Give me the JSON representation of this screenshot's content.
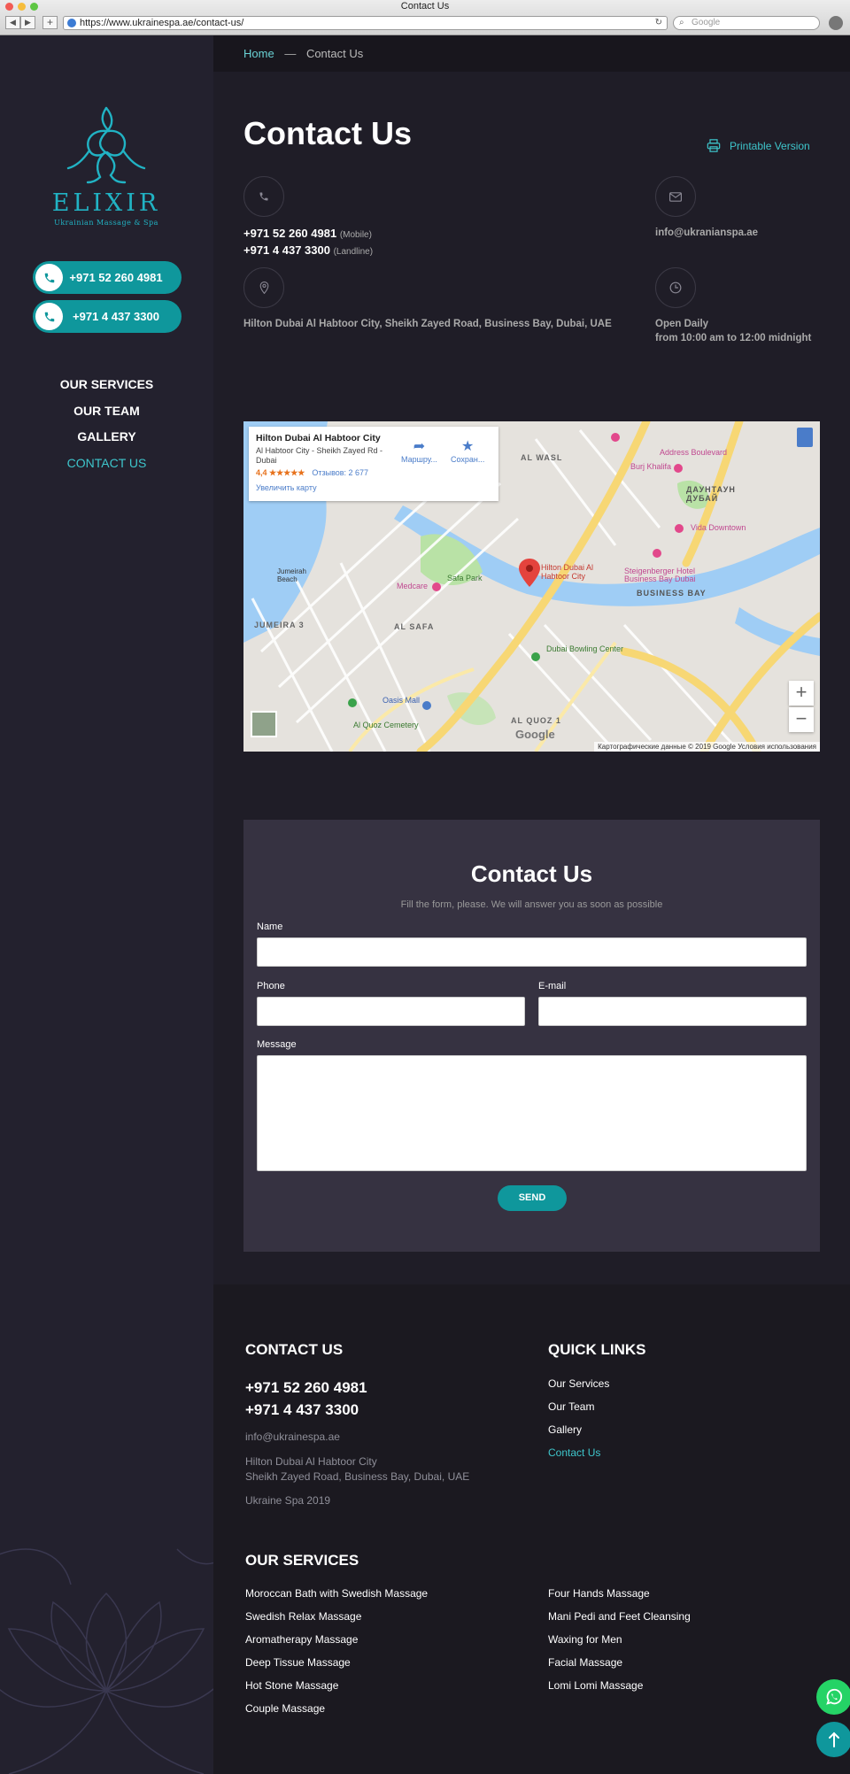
{
  "browser": {
    "window_title": "Contact Us",
    "url": "https://www.ukrainespa.ae/contact-us/",
    "search_placeholder": "Google"
  },
  "sidebar": {
    "brand": "ELIXIR",
    "tagline": "Ukrainian Massage & Spa",
    "phones": [
      "+971 52 260 4981",
      "+971 4 437 3300"
    ],
    "nav": [
      "OUR SERVICES",
      "OUR TEAM",
      "GALLERY",
      "CONTACT US"
    ],
    "active_nav": "CONTACT US"
  },
  "breadcrumb": {
    "home": "Home",
    "separator": "—",
    "current": "Contact Us"
  },
  "page": {
    "title": "Contact Us",
    "printable": "Printable Version",
    "phone_mobile": "+971 52 260 4981",
    "phone_mobile_note": "(Mobile)",
    "phone_landline": "+971 4 437 3300",
    "phone_landline_note": "(Landline)",
    "email": "info@ukranianspa.ae",
    "address": "Hilton Dubai Al Habtoor City, Sheikh Zayed Road, Business Bay, Dubai, UAE",
    "hours_line1": "Open Daily",
    "hours_line2": "from 10:00 am to 12:00 midnight"
  },
  "map": {
    "place_name": "Hilton Dubai Al Habtoor City",
    "place_address": "Al Habtoor City - Sheikh Zayed Rd - Dubai",
    "rating": "4,4 ★★★★★",
    "reviews": "Отзывов: 2 677",
    "enlarge": "Увеличить карту",
    "action_route": "Маршру...",
    "action_save": "Сохран...",
    "labels": [
      "AL WASL",
      "Burj Khalifa",
      "Address Boulevard",
      "ДАУНТАУН ДУБАЙ",
      "Vida Downtown",
      "Steigenberger Hotel Business Bay Dubai",
      "BUSINESS BAY",
      "Hilton Dubai Al Habtoor City",
      "Safa Park",
      "Medcare",
      "Jumeirah Beach",
      "AL SAFA",
      "JUMEIRA 3",
      "Dubai Bowling Center",
      "Oasis Mall",
      "Al Quoz Cemetery",
      "AL QUOZ 1"
    ],
    "footer": "Картографические данные © 2019 Google   Условия использования",
    "logo": "Google",
    "zoom_in": "+",
    "zoom_out": "−"
  },
  "form": {
    "title": "Contact Us",
    "subtitle": "Fill the form, please. We will answer you as soon as possible",
    "name_label": "Name",
    "phone_label": "Phone",
    "email_label": "E-mail",
    "message_label": "Message",
    "send": "SEND"
  },
  "footer": {
    "contact_heading": "CONTACT US",
    "phone1": "+971 52 260 4981",
    "phone2": "+971 4 437 3300",
    "email": "info@ukrainespa.ae",
    "address_line1": "Hilton Dubai Al Habtoor City",
    "address_line2": "Sheikh Zayed Road, Business Bay, Dubai, UAE",
    "copyright": "Ukraine Spa 2019",
    "quick_heading": "QUICK LINKS",
    "quick_links": [
      "Our Services",
      "Our Team",
      "Gallery",
      "Contact Us"
    ],
    "services_heading": "OUR SERVICES",
    "services_left": [
      "Moroccan Bath with Swedish Massage",
      "Swedish Relax Massage",
      "Aromatherapy Massage",
      "Deep Tissue Massage",
      "Hot Stone Massage",
      "Couple Massage"
    ],
    "services_right": [
      "Four Hands Massage",
      "Mani Pedi and Feet Cleansing",
      "Waxing for Men",
      "Facial Massage",
      "Lomi Lomi Massage"
    ]
  },
  "colors": {
    "accent": "#0f979c",
    "accent_text": "#3ec6cc",
    "sidebar_bg": "#23212e",
    "form_bg": "#363241",
    "whatsapp": "#25d366"
  },
  "icons": [
    "phone-icon",
    "mail-icon",
    "location-pin-icon",
    "clock-icon",
    "printer-icon",
    "whatsapp-icon",
    "arrow-up-icon"
  ]
}
